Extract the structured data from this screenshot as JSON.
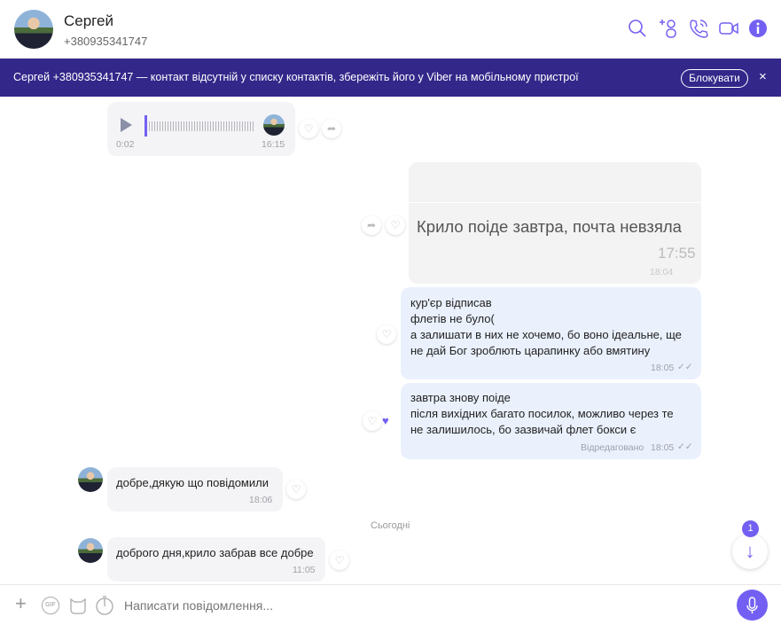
{
  "header": {
    "name": "Сергей",
    "phone": "+380935341747",
    "icons": [
      "search-icon",
      "add-participant-icon",
      "call-icon",
      "video-icon",
      "info-icon"
    ]
  },
  "banner": {
    "text": "Сергей +380935341747 — контакт відсутній у списку контактів, збережіть його у Viber на мобільному пристрої",
    "block_label": "Блокувати",
    "close": "×"
  },
  "messages": {
    "voice": {
      "duration": "0:02",
      "time": "16:15"
    },
    "image": {
      "text": "Крило поіде завтра, почта невзяла",
      "inner_time": "17:55",
      "time": "18:04"
    },
    "out1": {
      "lines": [
        "кур'єр відписав",
        "флетів не було(",
        "а залишати в них не хочемо, бо воно ідеальне, ще",
        "не дай Бог зроблють царапинку або вмятину"
      ],
      "time": "18:05"
    },
    "out2": {
      "lines": [
        "завтра знову поіде",
        "після вихідних багато посилок, можливо через те",
        "не залишилось, бо зазвичай флет бокси є"
      ],
      "edited": "Відредаговано",
      "time": "18:05"
    },
    "in1": {
      "text": "добре,дякую що повідомили",
      "time": "18:06"
    },
    "date_divider": "Сьогодні",
    "in2": {
      "text": "доброго дня,крило забрав все добре",
      "time": "11:05"
    }
  },
  "scroll": {
    "unread_badge": "1"
  },
  "composer": {
    "placeholder": "Написати повідомлення...",
    "gif": "GIF"
  },
  "colors": {
    "accent": "#7360f2",
    "banner": "#33278a",
    "outgoing": "#eaf1fd",
    "incoming": "#f4f4f6"
  }
}
